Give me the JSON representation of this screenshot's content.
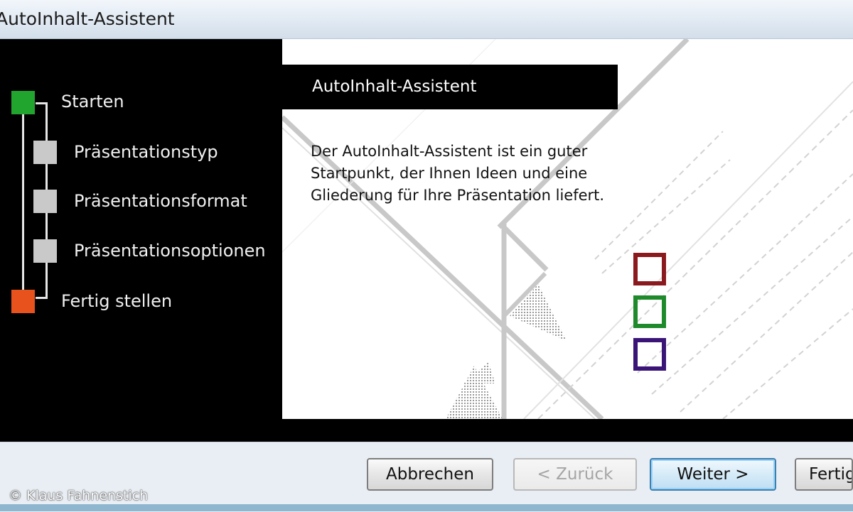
{
  "window": {
    "title": "AutoInhalt-Assistent"
  },
  "steps": [
    {
      "label": "Starten",
      "color": "#22a52e"
    },
    {
      "label": "Präsentationstyp",
      "color": "#c9c9c9"
    },
    {
      "label": "Präsentationsformat",
      "color": "#c9c9c9"
    },
    {
      "label": "Präsentationsoptionen",
      "color": "#c9c9c9"
    },
    {
      "label": "Fertig stellen",
      "color": "#e8521c"
    }
  ],
  "content": {
    "heading": "AutoInhalt-Assistent",
    "description": "Der AutoInhalt-Assistent ist ein guter Startpunkt, der Ihnen Ideen und eine Gliederung für Ihre Präsentation liefert."
  },
  "decor_colors": {
    "red": "#8b1a1f",
    "green": "#1f8a2c",
    "purple": "#3a1577"
  },
  "buttons": {
    "cancel": "Abbrechen",
    "back": "< Zurück",
    "next": "Weiter >",
    "finish": "Fertig stellen"
  },
  "copyright": "© Klaus Fahnenstich"
}
